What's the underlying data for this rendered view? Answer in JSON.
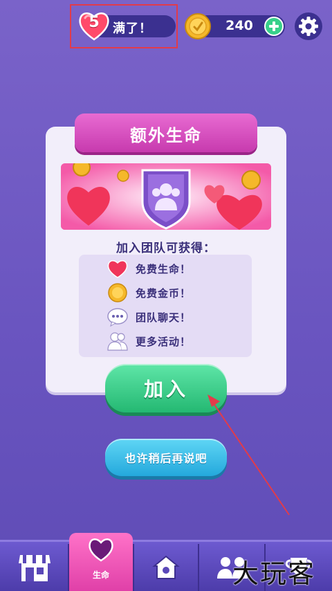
{
  "top_bar": {
    "lives_count": "5",
    "lives_status": "满了！",
    "coins": "240"
  },
  "dialog": {
    "title": "额外生命",
    "subtitle": "加入团队可获得：",
    "benefits": [
      {
        "icon": "heart-icon",
        "label": "免费生命！"
      },
      {
        "icon": "coin-icon",
        "label": "免费金币！"
      },
      {
        "icon": "chat-icon",
        "label": "团队聊天！"
      },
      {
        "icon": "people-icon",
        "label": "更多活动！"
      }
    ],
    "join_label": "加入",
    "later_label": "也许稍后再说吧"
  },
  "nav": {
    "items": [
      {
        "icon": "shop-icon",
        "label": ""
      },
      {
        "icon": "heart-icon",
        "label": "生命",
        "active": true
      },
      {
        "icon": "home-icon",
        "label": ""
      },
      {
        "icon": "team-icon",
        "label": ""
      },
      {
        "icon": "trophy-icon",
        "label": ""
      }
    ]
  },
  "watermark": "大玩客",
  "colors": {
    "background": "#6a55c0",
    "title_banner": "#c73aae",
    "join_button": "#24b872",
    "later_button": "#24a8dc",
    "highlight_box": "#e23b4a"
  }
}
